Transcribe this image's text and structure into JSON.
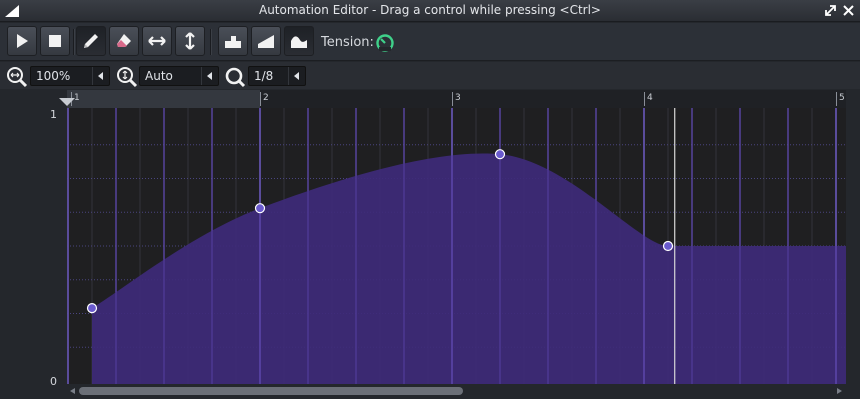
{
  "window": {
    "title": "Automation Editor - Drag a control while pressing <Ctrl>"
  },
  "toolbar": {
    "buttons": [
      {
        "name": "play-button",
        "icon": "play-icon"
      },
      {
        "name": "stop-button",
        "icon": "stop-icon"
      },
      {
        "name": "draw-mode-button",
        "icon": "pencil-icon",
        "active": true
      },
      {
        "name": "erase-mode-button",
        "icon": "eraser-icon"
      },
      {
        "name": "flip-horizontal-button",
        "icon": "arrows-horizontal-icon"
      },
      {
        "name": "flip-vertical-button",
        "icon": "arrows-vertical-icon"
      },
      {
        "name": "discrete-progression-button",
        "icon": "discrete-icon"
      },
      {
        "name": "linear-progression-button",
        "icon": "linear-icon"
      },
      {
        "name": "cubic-hermite-progression-button",
        "icon": "cubic-icon",
        "active": true
      }
    ],
    "tension_label": "Tension:",
    "tension_knob_color": "#3fd18a"
  },
  "zoom": {
    "horizontal_zoom": "100%",
    "vertical_zoom": "Auto",
    "quantization": "1/8"
  },
  "timeline": {
    "bar_numbers": [
      "1",
      "2",
      "3",
      "4",
      "5"
    ]
  },
  "y_axis": {
    "max_label": "1",
    "min_label": "0"
  },
  "automation": {
    "fill_color": "#3e2a7a",
    "line_color": "#8a7bdc",
    "point_color": "#6a5acd",
    "grid_color": "#6d4fd8",
    "points": [
      {
        "bar": 1.125,
        "value": 0.27
      },
      {
        "bar": 2.0,
        "value": 0.64
      },
      {
        "bar": 3.25,
        "value": 0.84
      },
      {
        "bar": 4.125,
        "value": 0.5
      }
    ],
    "end_value": 0.5,
    "playhead_bar": 4.16
  }
}
